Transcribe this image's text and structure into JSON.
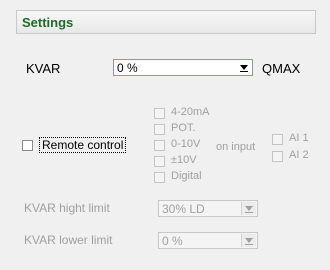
{
  "header": {
    "title": "Settings"
  },
  "kvar": {
    "label": "KVAR",
    "value": "0 %",
    "unit_label": "QMAX"
  },
  "remote": {
    "label": "Remote control",
    "options": [
      "4-20mA",
      "POT.",
      "0-10V",
      "±10V",
      "Digital"
    ],
    "on_input_label": "on input",
    "inputs": [
      "AI 1",
      "AI 2"
    ]
  },
  "limits": {
    "high_label": "KVAR hight limit",
    "high_value": "30% LD",
    "low_label": "KVAR lower limit",
    "low_value": "0 %"
  }
}
